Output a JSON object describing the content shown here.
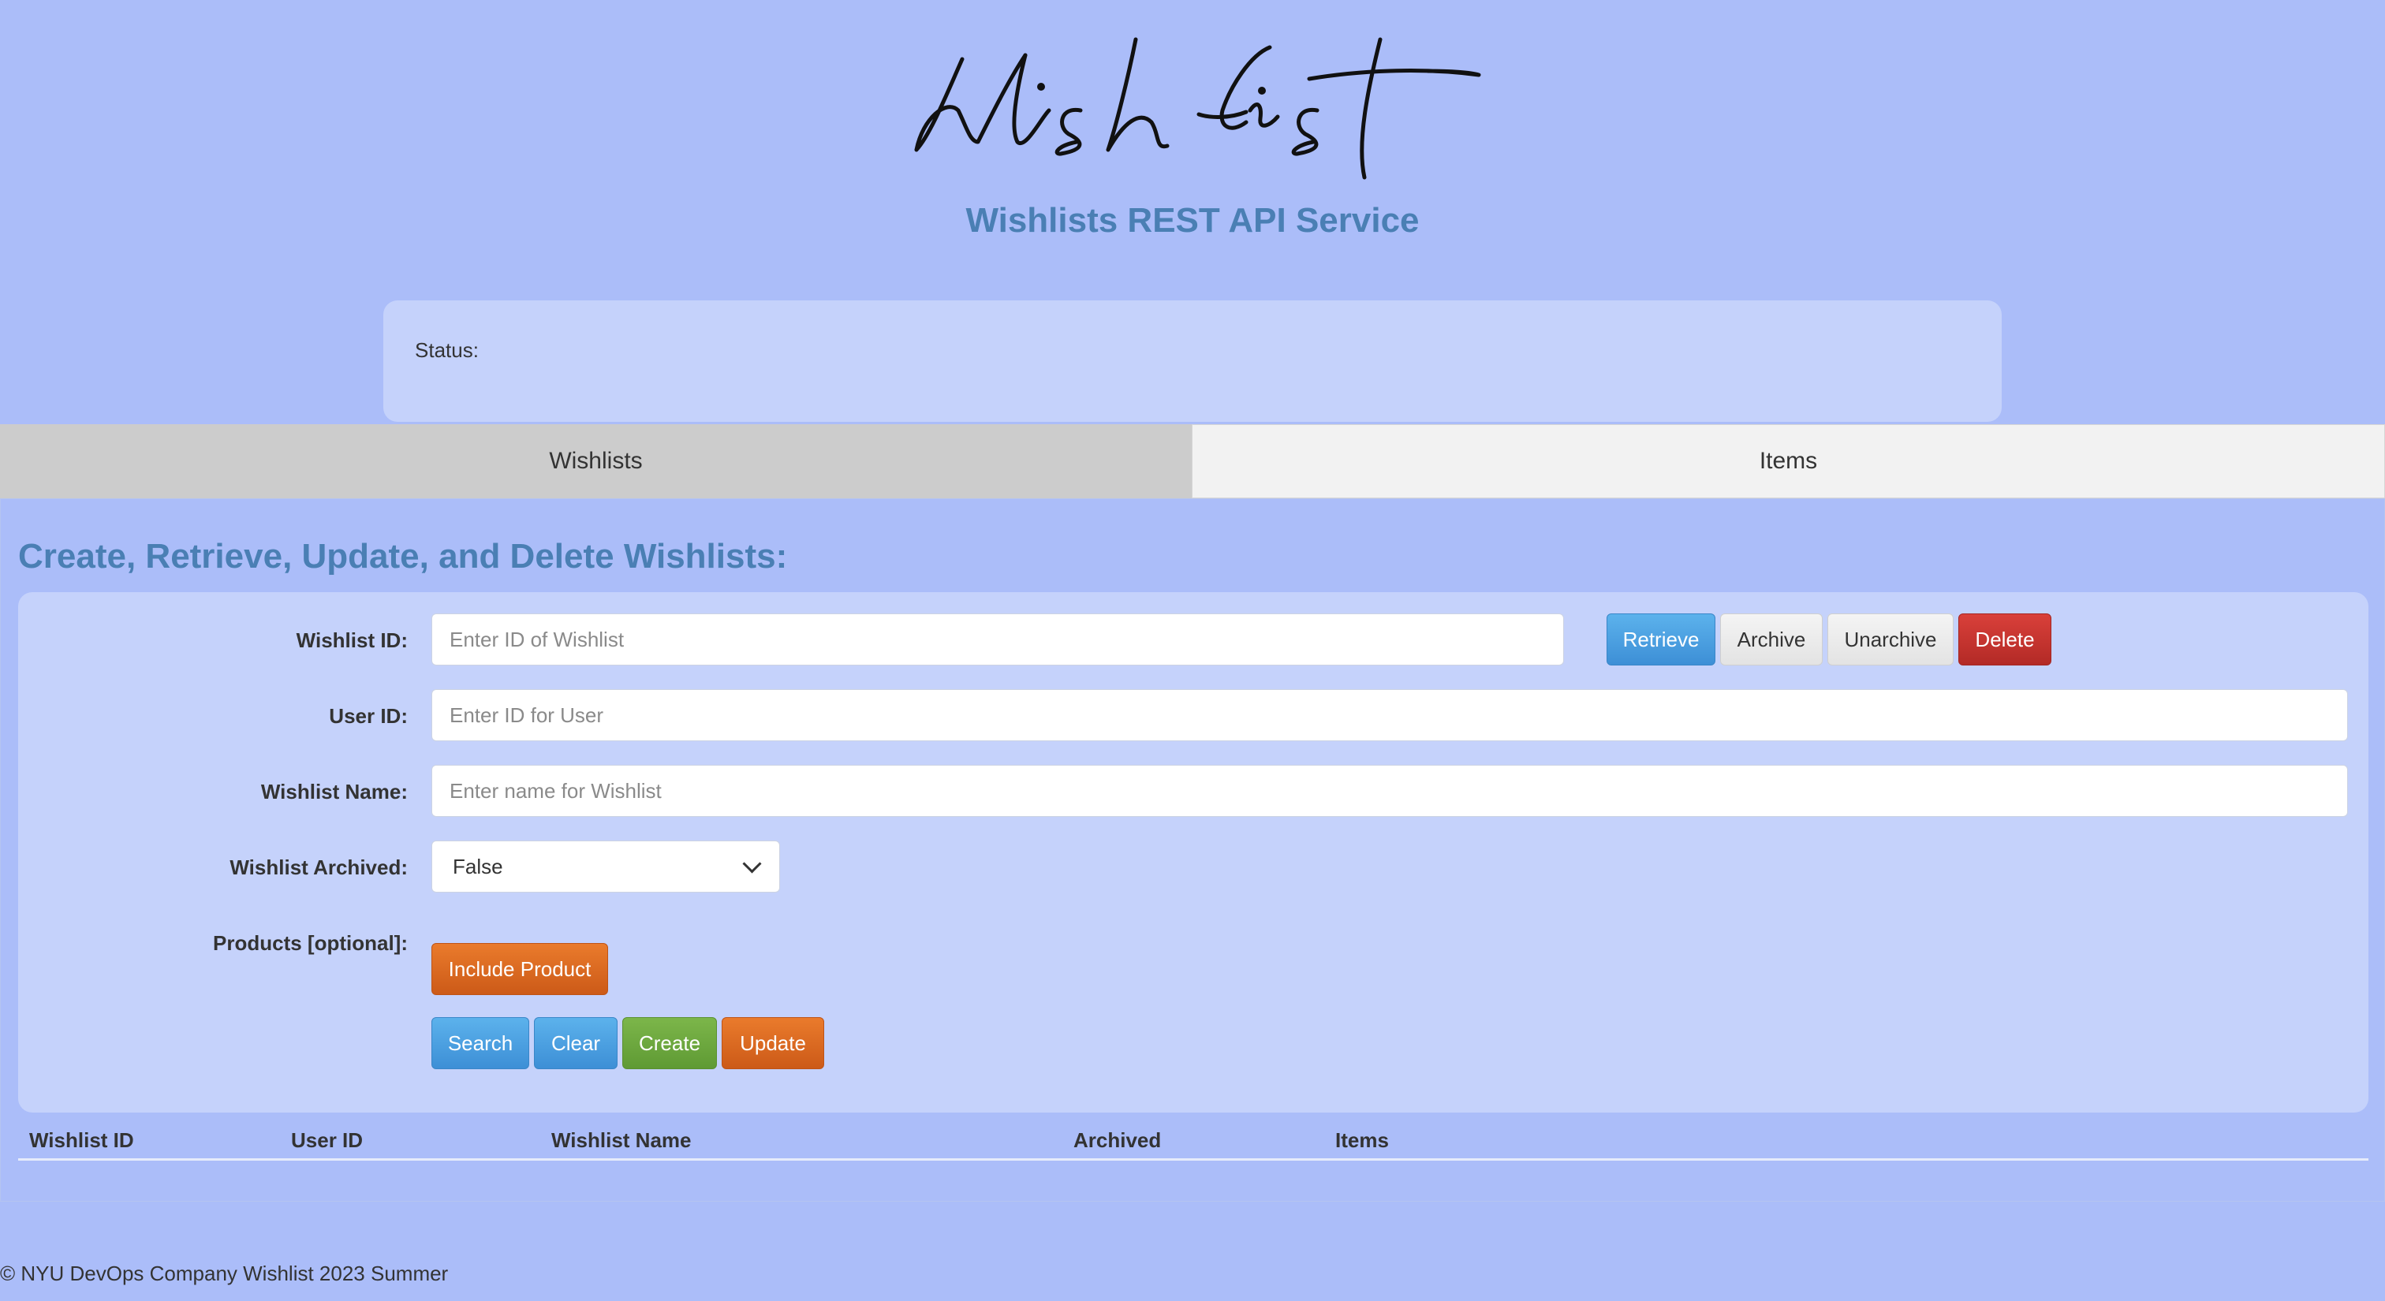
{
  "header": {
    "subtitle": "Wishlists REST API Service"
  },
  "status": {
    "label": "Status:"
  },
  "tabs": [
    {
      "label": "Wishlists",
      "active": true
    },
    {
      "label": "Items",
      "active": false
    }
  ],
  "section": {
    "title": "Create, Retrieve, Update, and Delete Wishlists:"
  },
  "form": {
    "wishlist_id": {
      "label": "Wishlist ID:",
      "placeholder": "Enter ID of Wishlist",
      "value": ""
    },
    "user_id": {
      "label": "User ID:",
      "placeholder": "Enter ID for User",
      "value": ""
    },
    "wishlist_name": {
      "label": "Wishlist Name:",
      "placeholder": "Enter name for Wishlist",
      "value": ""
    },
    "archived": {
      "label": "Wishlist Archived:",
      "value": "False"
    },
    "products": {
      "label": "Products [optional]:"
    }
  },
  "buttons": {
    "retrieve": "Retrieve",
    "archive": "Archive",
    "unarchive": "Unarchive",
    "delete": "Delete",
    "include_product": "Include Product",
    "search": "Search",
    "clear": "Clear",
    "create": "Create",
    "update": "Update"
  },
  "table": {
    "headers": [
      "Wishlist ID",
      "User ID",
      "Wishlist Name",
      "Archived",
      "Items"
    ],
    "rows": []
  },
  "footer": {
    "text": "© NYU DevOps Company Wishlist 2023 Summer"
  },
  "colors": {
    "background": "#abbdf9",
    "panel": "#c5d2fb",
    "heading": "#4a7fb4"
  }
}
